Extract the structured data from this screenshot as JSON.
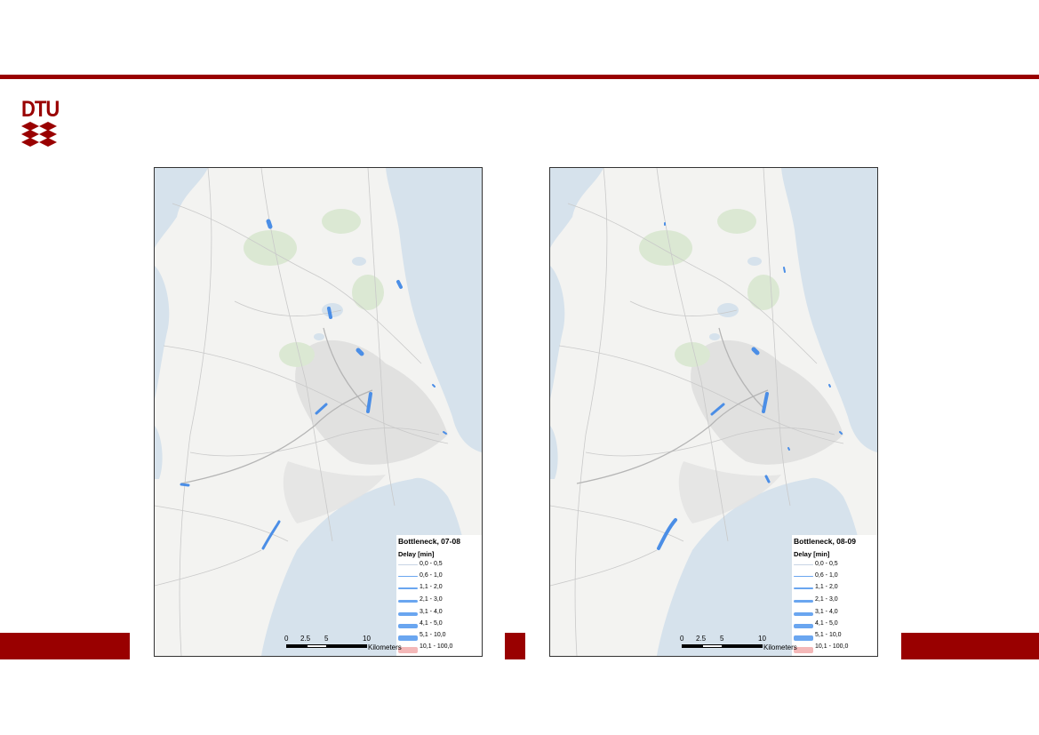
{
  "header": {
    "logo_text": "DTU",
    "brand_color": "#990000"
  },
  "maps": [
    {
      "title": "Bottleneck, 07-08",
      "legend_subtitle": "Delay [min]",
      "legend_items": [
        {
          "label": "0,0 - 0,5",
          "color": "#c8d4e4"
        },
        {
          "label": "0,6 - 1,0",
          "color": "#6aa6f0"
        },
        {
          "label": "1,1 - 2,0",
          "color": "#6aa6f0"
        },
        {
          "label": "2,1 - 3,0",
          "color": "#6aa6f0"
        },
        {
          "label": "3,1 - 4,0",
          "color": "#6aa6f0"
        },
        {
          "label": "4,1 - 5,0",
          "color": "#6aa6f0"
        },
        {
          "label": "5,1 - 10,0",
          "color": "#6aa6f0"
        },
        {
          "label": "10,1 - 100,0",
          "color": "#f4b8b8"
        }
      ],
      "scale": {
        "ticks": [
          "0",
          "2.5",
          "5",
          "10"
        ],
        "unit": "Kilometers"
      }
    },
    {
      "title": "Bottleneck, 08-09",
      "legend_subtitle": "Delay [min]",
      "legend_items": [
        {
          "label": "0,0 - 0,5",
          "color": "#c8d4e4"
        },
        {
          "label": "0,6 - 1,0",
          "color": "#6aa6f0"
        },
        {
          "label": "1,1 - 2,0",
          "color": "#6aa6f0"
        },
        {
          "label": "2,1 - 3,0",
          "color": "#6aa6f0"
        },
        {
          "label": "3,1 - 4,0",
          "color": "#6aa6f0"
        },
        {
          "label": "4,1 - 5,0",
          "color": "#6aa6f0"
        },
        {
          "label": "5,1 - 10,0",
          "color": "#6aa6f0"
        },
        {
          "label": "10,1 - 100,0",
          "color": "#f4b8b8"
        }
      ],
      "scale": {
        "ticks": [
          "0",
          "2.5",
          "5",
          "10"
        ],
        "unit": "Kilometers"
      }
    }
  ],
  "colors": {
    "water": "#d6e2ec",
    "land": "#f3f3f1",
    "urban": "#dddddd",
    "forest": "#dbe8d3",
    "bottleneck": "#4b8ee6"
  }
}
